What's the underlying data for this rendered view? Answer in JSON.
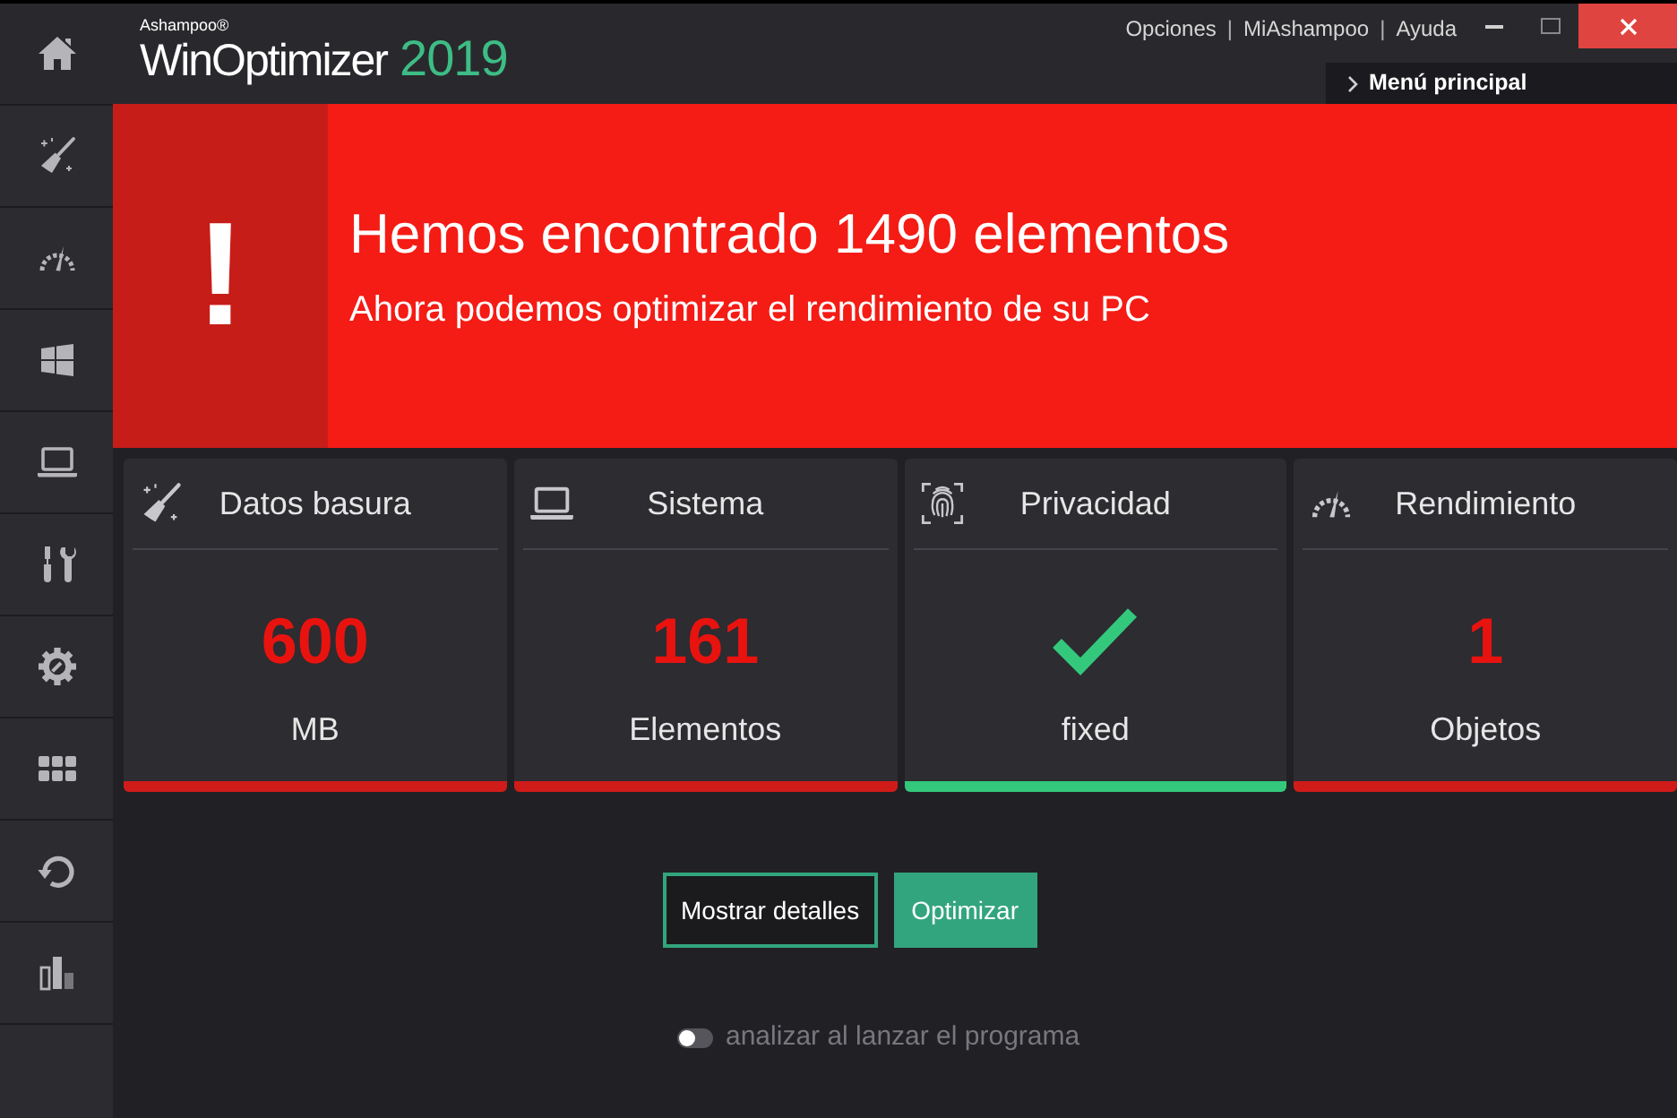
{
  "header": {
    "brand": "Ashampoo®",
    "product": "WinOptimizer",
    "version": "2019",
    "links": [
      "Opciones",
      "MiAshampoo",
      "Ayuda"
    ],
    "link_separator": "|",
    "main_menu": "Menú principal"
  },
  "banner": {
    "symbol": "!",
    "title": "Hemos encontrado 1490 elementos",
    "subtitle": "Ahora podemos optimizar el rendimiento de su PC"
  },
  "cards": [
    {
      "title": "Datos basura",
      "kind": "count",
      "value": "600",
      "unit": "MB",
      "color": "#d01c19"
    },
    {
      "title": "Sistema",
      "kind": "count",
      "value": "161",
      "unit": "Elementos",
      "color": "#d01c19"
    },
    {
      "title": "Privacidad",
      "kind": "check",
      "unit": "fixed",
      "color": "#33c87c"
    },
    {
      "title": "Rendimiento",
      "kind": "count",
      "value": "1",
      "unit": "Objetos",
      "color": "#d01c19"
    }
  ],
  "buttons": [
    {
      "label": "Mostrar detalles",
      "kind": "outline"
    },
    {
      "label": "Optimizar",
      "kind": "primary"
    }
  ],
  "startup_scan": {
    "label": "analizar al lanzar el programa",
    "on": false
  }
}
